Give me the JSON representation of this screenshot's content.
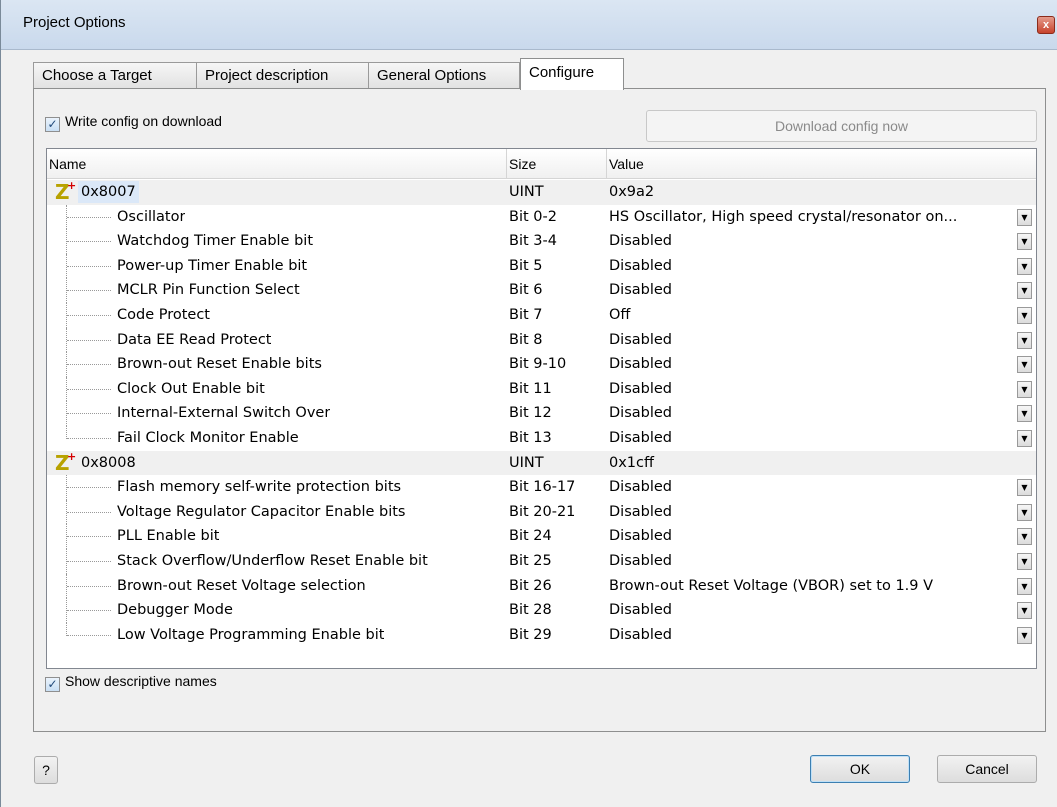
{
  "window": {
    "title": "Project Options",
    "close_glyph": "x"
  },
  "tabs": [
    {
      "label": "Choose a Target",
      "active": false
    },
    {
      "label": "Project description",
      "active": false
    },
    {
      "label": "General Options",
      "active": false
    },
    {
      "label": "Configure",
      "active": true
    }
  ],
  "configure": {
    "write_config_label": "Write config on download",
    "write_config_checked": true,
    "download_button": "Download config now",
    "show_names_label": "Show descriptive names",
    "show_names_checked": true
  },
  "table": {
    "headers": {
      "name": "Name",
      "size": "Size",
      "value": "Value"
    },
    "groups": [
      {
        "address": "0x8007",
        "size": "UINT",
        "value": "0x9a2",
        "selected": true,
        "items": [
          {
            "name": "Oscillator",
            "size": "Bit 0-2",
            "value": "HS Oscillator, High speed crystal/resonator on..."
          },
          {
            "name": "Watchdog Timer Enable bit",
            "size": "Bit 3-4",
            "value": "Disabled"
          },
          {
            "name": "Power-up Timer Enable bit",
            "size": "Bit 5",
            "value": "Disabled"
          },
          {
            "name": "MCLR Pin Function Select",
            "size": "Bit 6",
            "value": "Disabled"
          },
          {
            "name": "Code Protect",
            "size": "Bit 7",
            "value": "Off"
          },
          {
            "name": "Data EE Read Protect",
            "size": "Bit 8",
            "value": "Disabled"
          },
          {
            "name": "Brown-out Reset Enable bits",
            "size": "Bit 9-10",
            "value": "Disabled"
          },
          {
            "name": "Clock Out Enable bit",
            "size": "Bit 11",
            "value": "Disabled"
          },
          {
            "name": "Internal-External Switch Over",
            "size": "Bit 12",
            "value": "Disabled"
          },
          {
            "name": "Fail Clock Monitor Enable",
            "size": "Bit 13",
            "value": "Disabled"
          }
        ]
      },
      {
        "address": "0x8008",
        "size": "UINT",
        "value": "0x1cff",
        "selected": false,
        "items": [
          {
            "name": "Flash memory self-write protection bits",
            "size": "Bit 16-17",
            "value": "Disabled"
          },
          {
            "name": "Voltage Regulator Capacitor Enable bits",
            "size": "Bit 20-21",
            "value": "Disabled"
          },
          {
            "name": "PLL Enable bit",
            "size": "Bit 24",
            "value": "Disabled"
          },
          {
            "name": "Stack Overflow/Underflow Reset Enable bit",
            "size": "Bit 25",
            "value": "Disabled"
          },
          {
            "name": "Brown-out Reset Voltage selection",
            "size": "Bit 26",
            "value": "Brown-out Reset Voltage (VBOR) set to 1.9 V"
          },
          {
            "name": "Debugger Mode",
            "size": "Bit 28",
            "value": "Disabled"
          },
          {
            "name": "Low Voltage Programming Enable bit",
            "size": "Bit 29",
            "value": "Disabled"
          }
        ]
      }
    ]
  },
  "footer": {
    "help_button": "?",
    "ok_button": "OK",
    "cancel_button": "Cancel"
  },
  "icons": {
    "group_icon": "config-z-icon",
    "dropdown": "chevron-down-icon"
  }
}
